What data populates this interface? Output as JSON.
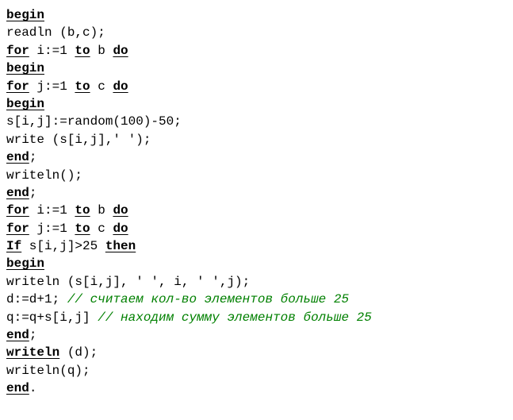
{
  "lines": [
    {
      "segments": [
        {
          "t": "begin",
          "c": "kw"
        }
      ]
    },
    {
      "segments": [
        {
          "t": "readln (b,c);",
          "c": ""
        }
      ]
    },
    {
      "segments": [
        {
          "t": "for",
          "c": "kw"
        },
        {
          "t": " i:=1 ",
          "c": ""
        },
        {
          "t": "to",
          "c": "kw"
        },
        {
          "t": " b ",
          "c": ""
        },
        {
          "t": "do",
          "c": "kw"
        }
      ]
    },
    {
      "segments": [
        {
          "t": "begin",
          "c": "kw"
        }
      ]
    },
    {
      "segments": [
        {
          "t": "for",
          "c": "kw"
        },
        {
          "t": " j:=1 ",
          "c": ""
        },
        {
          "t": "to",
          "c": "kw"
        },
        {
          "t": " c ",
          "c": ""
        },
        {
          "t": "do",
          "c": "kw"
        }
      ]
    },
    {
      "segments": [
        {
          "t": "begin",
          "c": "kw"
        }
      ]
    },
    {
      "segments": [
        {
          "t": "s[i,j]:=random(100)-50;",
          "c": ""
        }
      ]
    },
    {
      "segments": [
        {
          "t": "write (s[i,j],' ');",
          "c": ""
        }
      ]
    },
    {
      "segments": [
        {
          "t": "end",
          "c": "kw"
        },
        {
          "t": ";",
          "c": ""
        }
      ]
    },
    {
      "segments": [
        {
          "t": "writeln();",
          "c": ""
        }
      ]
    },
    {
      "segments": [
        {
          "t": "end",
          "c": "kw"
        },
        {
          "t": ";",
          "c": ""
        }
      ]
    },
    {
      "segments": [
        {
          "t": "for",
          "c": "kw"
        },
        {
          "t": " i:=1 ",
          "c": ""
        },
        {
          "t": "to",
          "c": "kw"
        },
        {
          "t": " b ",
          "c": ""
        },
        {
          "t": "do",
          "c": "kw"
        }
      ]
    },
    {
      "segments": [
        {
          "t": "for",
          "c": "kw"
        },
        {
          "t": " j:=1 ",
          "c": ""
        },
        {
          "t": "to",
          "c": "kw"
        },
        {
          "t": " c ",
          "c": ""
        },
        {
          "t": "do",
          "c": "kw"
        }
      ]
    },
    {
      "segments": [
        {
          "t": "If",
          "c": "kw"
        },
        {
          "t": " s[i,j]>25 ",
          "c": ""
        },
        {
          "t": "then",
          "c": "kw"
        }
      ]
    },
    {
      "segments": [
        {
          "t": "begin",
          "c": "kw"
        }
      ]
    },
    {
      "segments": [
        {
          "t": "writeln (s[i,j], ' ', i, ' ',j);",
          "c": ""
        }
      ]
    },
    {
      "segments": [
        {
          "t": "d:=d+1; ",
          "c": ""
        },
        {
          "t": "// считаем кол-во элементов больше 25",
          "c": "comment"
        }
      ]
    },
    {
      "segments": [
        {
          "t": "q:=q+s[i,j] ",
          "c": ""
        },
        {
          "t": "// находим сумму элементов больше 25",
          "c": "comment"
        }
      ]
    },
    {
      "segments": [
        {
          "t": "end",
          "c": "kw"
        },
        {
          "t": ";",
          "c": ""
        }
      ]
    },
    {
      "segments": [
        {
          "t": "writeln",
          "c": "kw"
        },
        {
          "t": " (d);",
          "c": ""
        }
      ]
    },
    {
      "segments": [
        {
          "t": "writeln(q);",
          "c": ""
        }
      ]
    },
    {
      "segments": [
        {
          "t": "end",
          "c": "kw"
        },
        {
          "t": ".",
          "c": ""
        }
      ]
    }
  ]
}
